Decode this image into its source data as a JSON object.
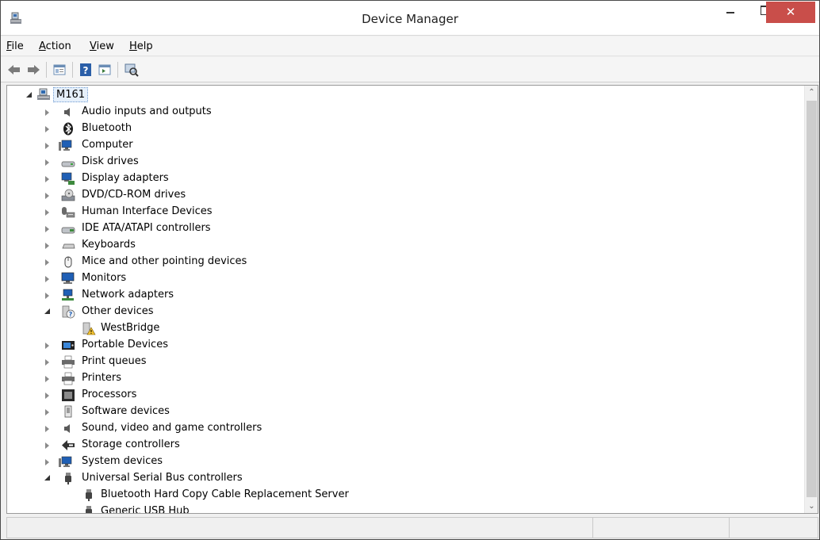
{
  "window": {
    "title": "Device Manager",
    "close_glyph": "✕"
  },
  "menu": [
    {
      "label": "File",
      "u": "F",
      "rest": "ile"
    },
    {
      "label": "Action",
      "u": "A",
      "rest": "ction"
    },
    {
      "label": "View",
      "u": "V",
      "rest": "iew"
    },
    {
      "label": "Help",
      "u": "H",
      "rest": "elp"
    }
  ],
  "toolbar": {
    "buttons": [
      "back-icon",
      "forward-icon",
      "properties-sheet-icon",
      "help-icon",
      "action-pane-icon",
      "scan-hardware-icon"
    ]
  },
  "tree": {
    "root": {
      "label": "M161",
      "icon": "computer-tower-icon"
    },
    "items": [
      {
        "label": "Audio inputs and outputs",
        "icon": "speaker-icon",
        "state": "collapsed"
      },
      {
        "label": "Bluetooth",
        "icon": "bluetooth-icon",
        "state": "collapsed"
      },
      {
        "label": "Computer",
        "icon": "computer-icon",
        "state": "collapsed"
      },
      {
        "label": "Disk drives",
        "icon": "disk-drive-icon",
        "state": "collapsed"
      },
      {
        "label": "Display adapters",
        "icon": "display-adapter-icon",
        "state": "collapsed"
      },
      {
        "label": "DVD/CD-ROM drives",
        "icon": "dvd-drive-icon",
        "state": "collapsed"
      },
      {
        "label": "Human Interface Devices",
        "icon": "hid-icon",
        "state": "collapsed"
      },
      {
        "label": "IDE ATA/ATAPI controllers",
        "icon": "ide-controller-icon",
        "state": "collapsed"
      },
      {
        "label": "Keyboards",
        "icon": "keyboard-icon",
        "state": "collapsed"
      },
      {
        "label": "Mice and other pointing devices",
        "icon": "mouse-icon",
        "state": "collapsed"
      },
      {
        "label": "Monitors",
        "icon": "monitor-icon",
        "state": "collapsed"
      },
      {
        "label": "Network adapters",
        "icon": "network-adapter-icon",
        "state": "collapsed"
      },
      {
        "label": "Other devices",
        "icon": "unknown-device-icon",
        "state": "expanded"
      },
      {
        "label": "WestBridge",
        "icon": "warning-device-icon",
        "state": "child"
      },
      {
        "label": "Portable Devices",
        "icon": "portable-device-icon",
        "state": "collapsed"
      },
      {
        "label": "Print queues",
        "icon": "print-queue-icon",
        "state": "collapsed"
      },
      {
        "label": "Printers",
        "icon": "printer-icon",
        "state": "collapsed"
      },
      {
        "label": "Processors",
        "icon": "processor-icon",
        "state": "collapsed"
      },
      {
        "label": "Software devices",
        "icon": "software-device-icon",
        "state": "collapsed"
      },
      {
        "label": "Sound, video and game controllers",
        "icon": "sound-controller-icon",
        "state": "collapsed"
      },
      {
        "label": "Storage controllers",
        "icon": "storage-controller-icon",
        "state": "collapsed"
      },
      {
        "label": "System devices",
        "icon": "system-device-icon",
        "state": "collapsed"
      },
      {
        "label": "Universal Serial Bus controllers",
        "icon": "usb-icon",
        "state": "expanded"
      },
      {
        "label": "Bluetooth Hard Copy Cable Replacement Server",
        "icon": "usb-plug-icon",
        "state": "child"
      },
      {
        "label": "Generic USB Hub",
        "icon": "usb-plug-icon",
        "state": "child"
      }
    ]
  },
  "scrollbar": {
    "up_glyph": "⌃",
    "down_glyph": "⌄"
  },
  "statusbar": {
    "cells": [
      "",
      "",
      ""
    ]
  }
}
